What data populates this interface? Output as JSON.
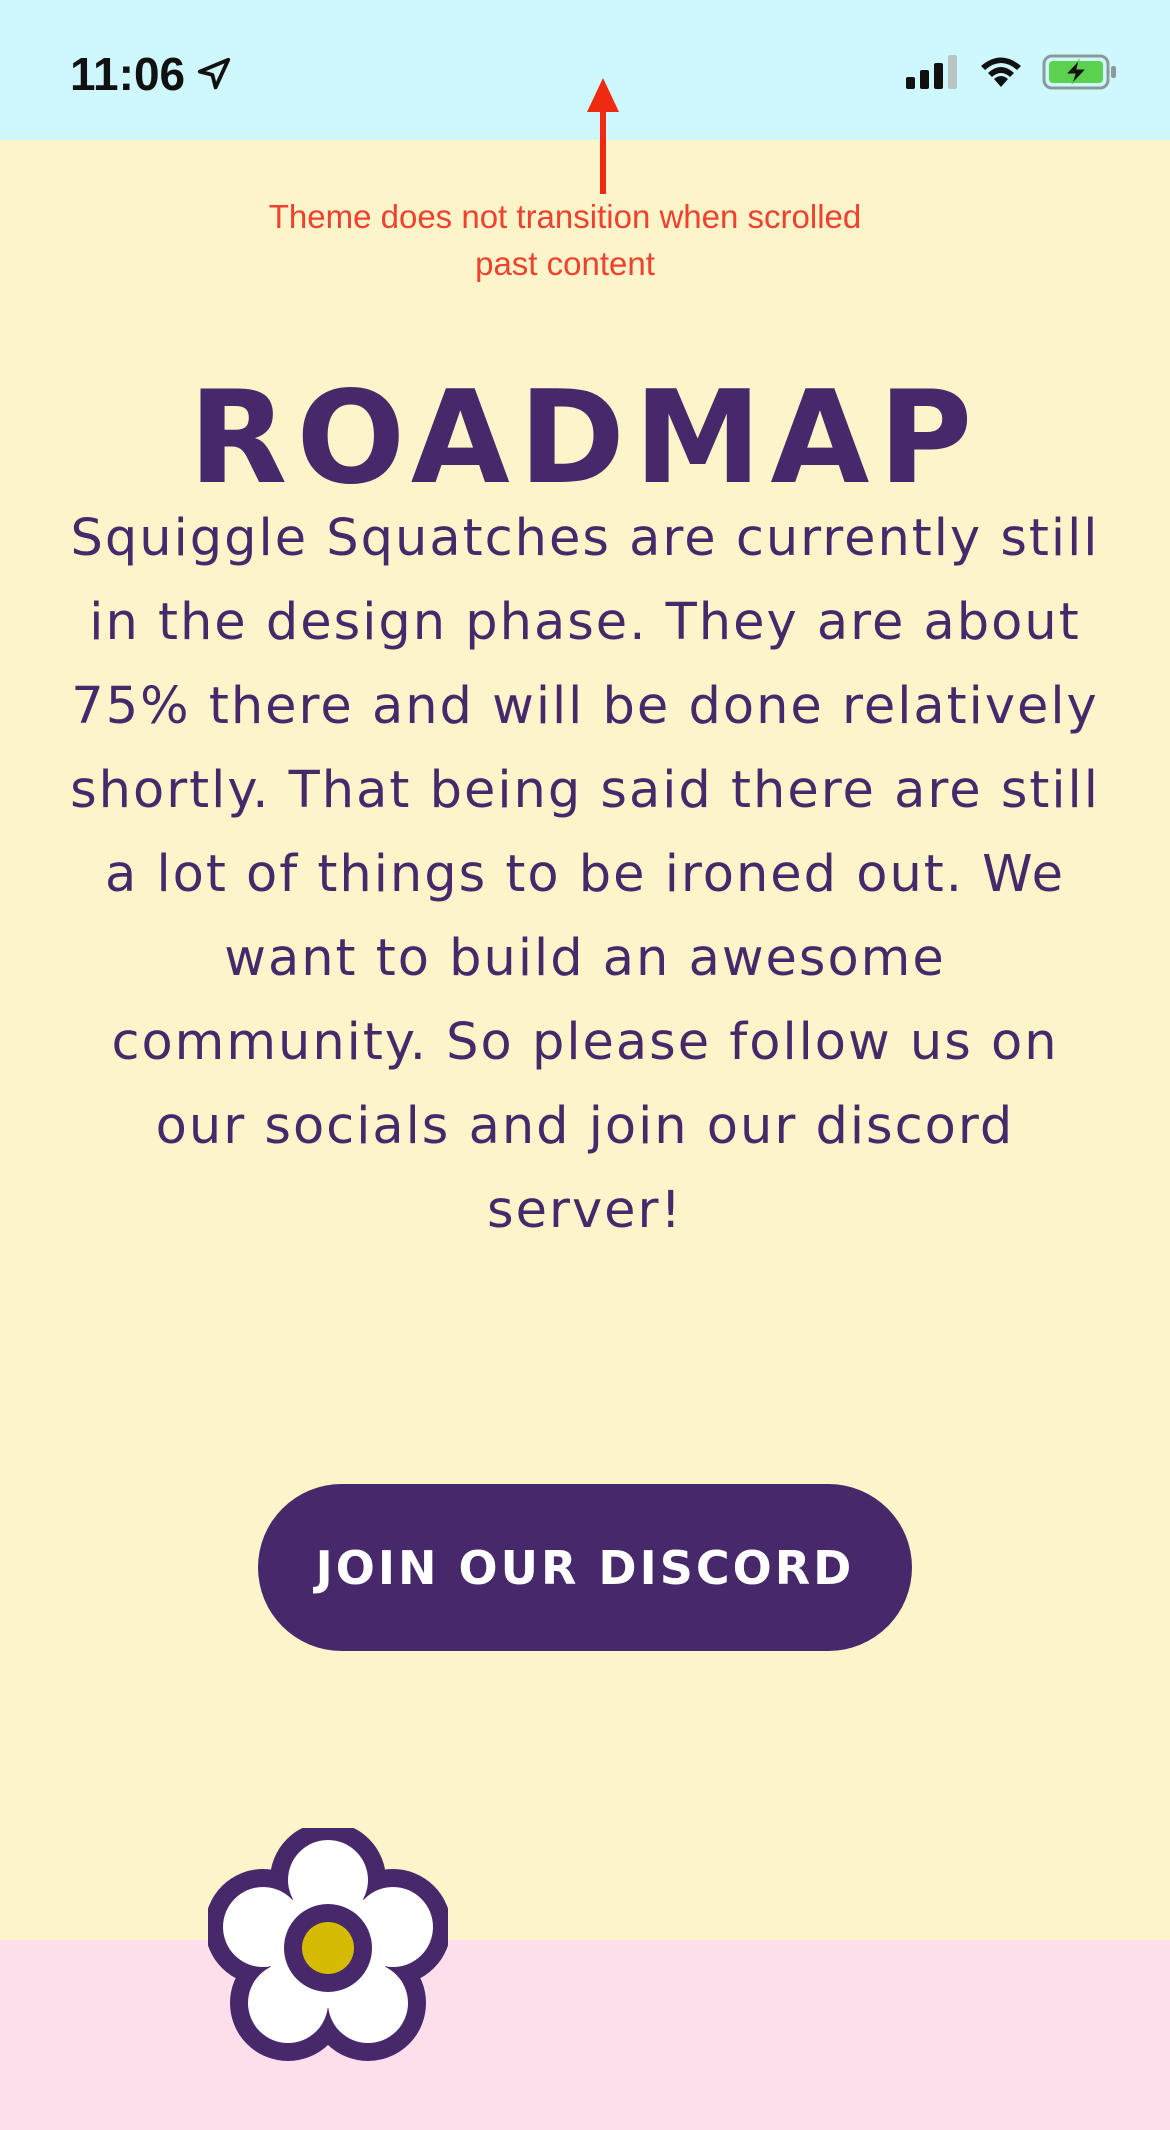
{
  "status_bar": {
    "time": "11:06",
    "location_icon": "location-arrow-icon",
    "signal_icon": "cellular-signal-icon",
    "wifi_icon": "wifi-icon",
    "battery_icon": "battery-charging-icon",
    "background_color": "#cef8fd"
  },
  "annotation": {
    "arrow_icon": "up-arrow-icon",
    "text": "Theme does not transition when scrolled past content",
    "color": "#ee4130"
  },
  "main": {
    "title": "ROADMAP",
    "description": "Squiggle Squatches are currently still in the design phase. They are about 75% there and will be done relatively shortly. That being said there are still a lot of things to be ironed out. We want to build an awesome community. So please follow us on our socials and join our discord server!",
    "cta_label": "JOIN OUR DISCORD",
    "background_color": "#fdf5c9",
    "accent_color": "#47286b"
  },
  "footer": {
    "flower_icon": "flower-icon",
    "background_color": "#fddeeb"
  }
}
